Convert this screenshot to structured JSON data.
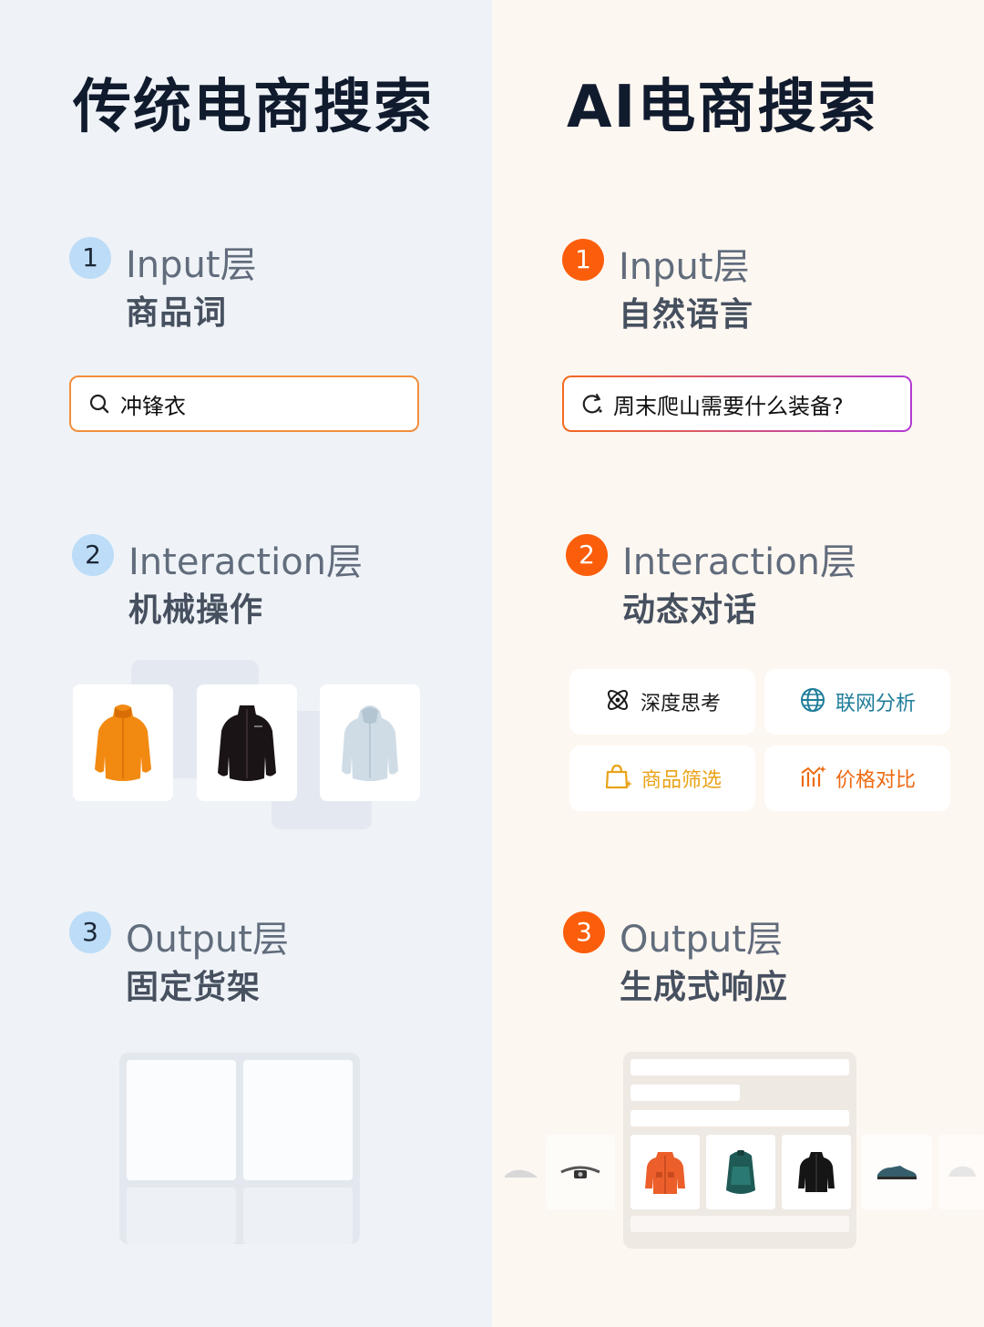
{
  "left": {
    "title": "传统电商搜索",
    "steps": [
      {
        "num": "1",
        "layer": "Input层",
        "sub": "商品词"
      },
      {
        "num": "2",
        "layer": "Interaction层",
        "sub": "机械操作"
      },
      {
        "num": "3",
        "layer": "Output层",
        "sub": "固定货架"
      }
    ],
    "search": {
      "text": "冲锋衣",
      "icon": "search-icon"
    }
  },
  "right": {
    "title": "AI电商搜索",
    "steps": [
      {
        "num": "1",
        "layer": "Input层",
        "sub": "自然语言"
      },
      {
        "num": "2",
        "layer": "Interaction层",
        "sub": "动态对话"
      },
      {
        "num": "3",
        "layer": "Output层",
        "sub": "生成式响应"
      }
    ],
    "search": {
      "text": "周末爬山需要什么装备?",
      "icon": "ai-refresh-icon"
    },
    "chips": [
      {
        "label": "深度思考",
        "icon": "atom-icon",
        "color": "#1a1a1a"
      },
      {
        "label": "联网分析",
        "icon": "globe-icon",
        "color": "#1f7d9a"
      },
      {
        "label": "商品筛选",
        "icon": "shopping-bag-icon",
        "color": "#e9a318"
      },
      {
        "label": "价格对比",
        "icon": "price-chart-icon",
        "color": "#ee6a13"
      }
    ]
  },
  "colors": {
    "left_bg": "#eff3f7",
    "right_bg": "#fdf7f1",
    "left_badge": "#bcdcf7",
    "right_badge": "#fb5e0b"
  }
}
